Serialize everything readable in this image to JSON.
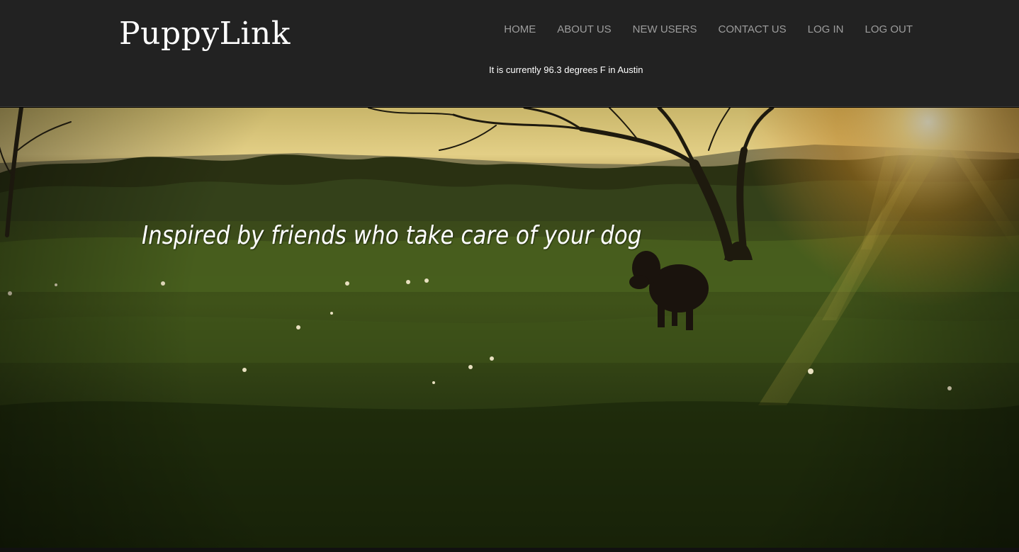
{
  "brand": {
    "name": "PuppyLink"
  },
  "nav": {
    "items": [
      {
        "label": "HOME"
      },
      {
        "label": "ABOUT US"
      },
      {
        "label": "NEW USERS"
      },
      {
        "label": "CONTACT US"
      },
      {
        "label": "LOG IN"
      },
      {
        "label": "LOG OUT"
      }
    ]
  },
  "weather": {
    "text": "It is currently 96.3 degrees F in Austin"
  },
  "hero": {
    "tagline": "Inspired by friends who take care of your dog",
    "image": "sunset-meadow-dog-photo"
  },
  "colors": {
    "header_bg": "#222222",
    "nav_text": "#9d9d9d",
    "text_white": "#ffffff"
  }
}
